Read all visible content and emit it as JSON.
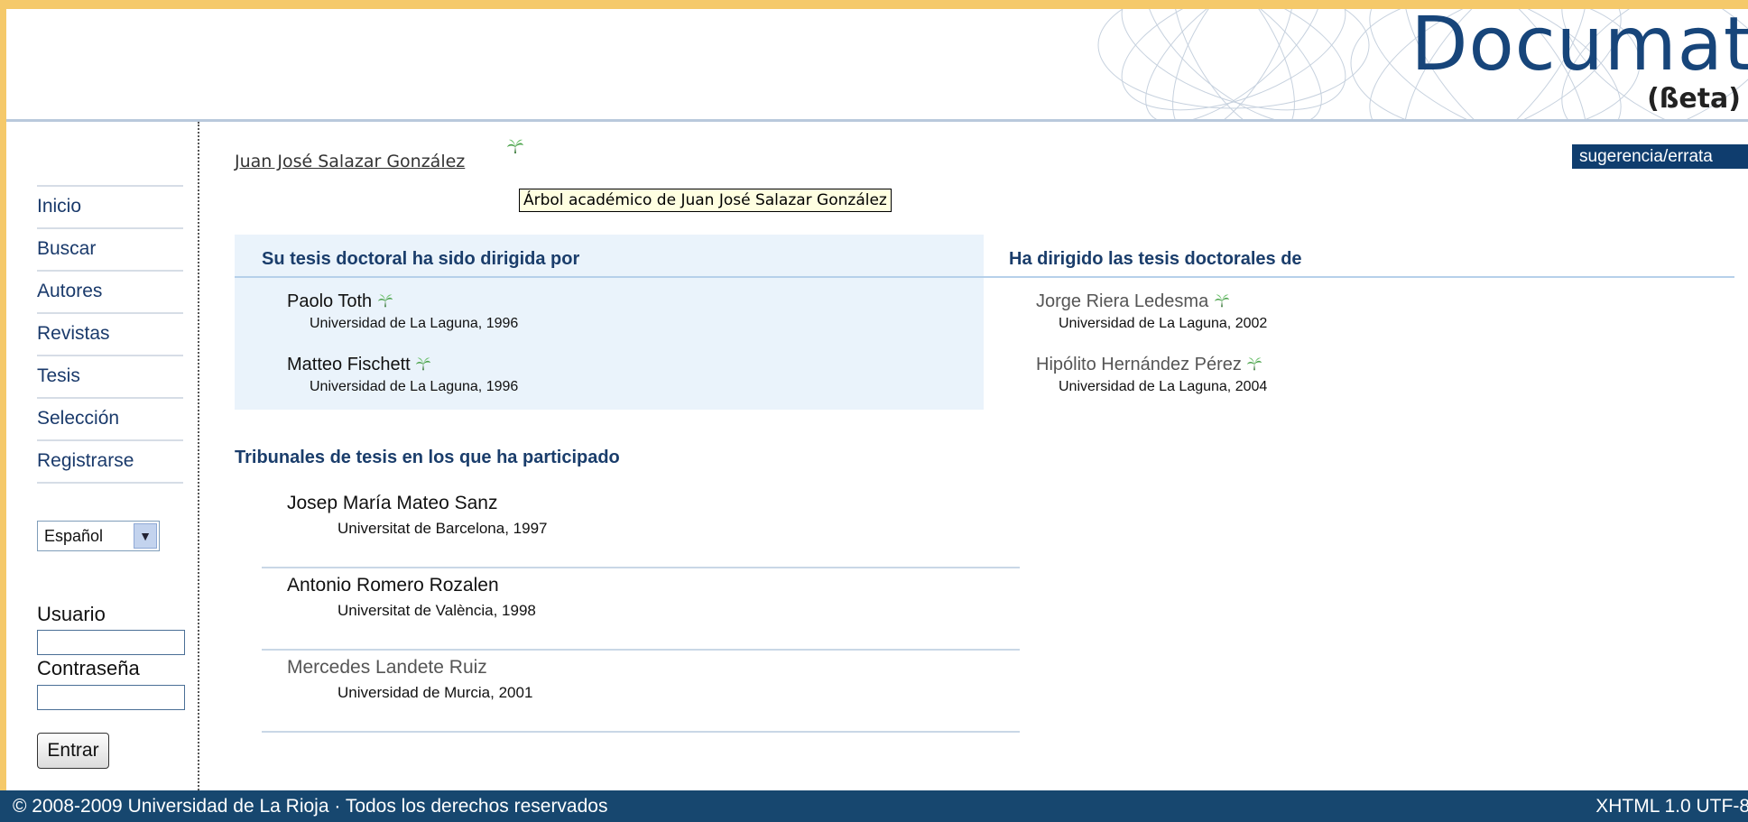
{
  "logo": {
    "text": "Documat",
    "beta": "(ßeta)"
  },
  "header": {
    "suggest_link": "sugerencia/errata"
  },
  "sidebar": {
    "nav": [
      {
        "label": "Inicio"
      },
      {
        "label": "Buscar"
      },
      {
        "label": "Autores"
      },
      {
        "label": "Revistas"
      },
      {
        "label": "Tesis"
      },
      {
        "label": "Selección"
      },
      {
        "label": "Registrarse"
      }
    ],
    "language": "Español",
    "user_label": "Usuario",
    "password_label": "Contraseña",
    "login_button": "Entrar"
  },
  "author": {
    "name": "Juan José Salazar González",
    "tree_tooltip": "Árbol académico de Juan José Salazar González"
  },
  "advisors": {
    "heading": "Su tesis doctoral ha sido dirigida por",
    "items": [
      {
        "name": "Paolo Toth",
        "inst": "Universidad de La Laguna, 1996"
      },
      {
        "name": "Matteo Fischett",
        "inst": "Universidad de La Laguna, 1996"
      }
    ]
  },
  "students": {
    "heading": "Ha dirigido las tesis doctorales de",
    "items": [
      {
        "name": "Jorge Riera Ledesma",
        "inst": "Universidad de La Laguna, 2002"
      },
      {
        "name": "Hipólito Hernández Pérez",
        "inst": "Universidad de La Laguna, 2004"
      }
    ]
  },
  "tribunals": {
    "heading": "Tribunales de tesis en los que ha participado",
    "items": [
      {
        "name": "Josep María Mateo Sanz",
        "inst": "Universitat de Barcelona, 1997"
      },
      {
        "name": "Antonio Romero Rozalen",
        "inst": "Universitat de València, 1998"
      },
      {
        "name": "Mercedes Landete Ruiz",
        "inst": "Universidad de Murcia, 2001"
      }
    ]
  },
  "footer": {
    "copyright": "© 2008-2009 Universidad de La Rioja · Todos los derechos reservados",
    "tech": "XHTML 1.0 UTF-8"
  }
}
